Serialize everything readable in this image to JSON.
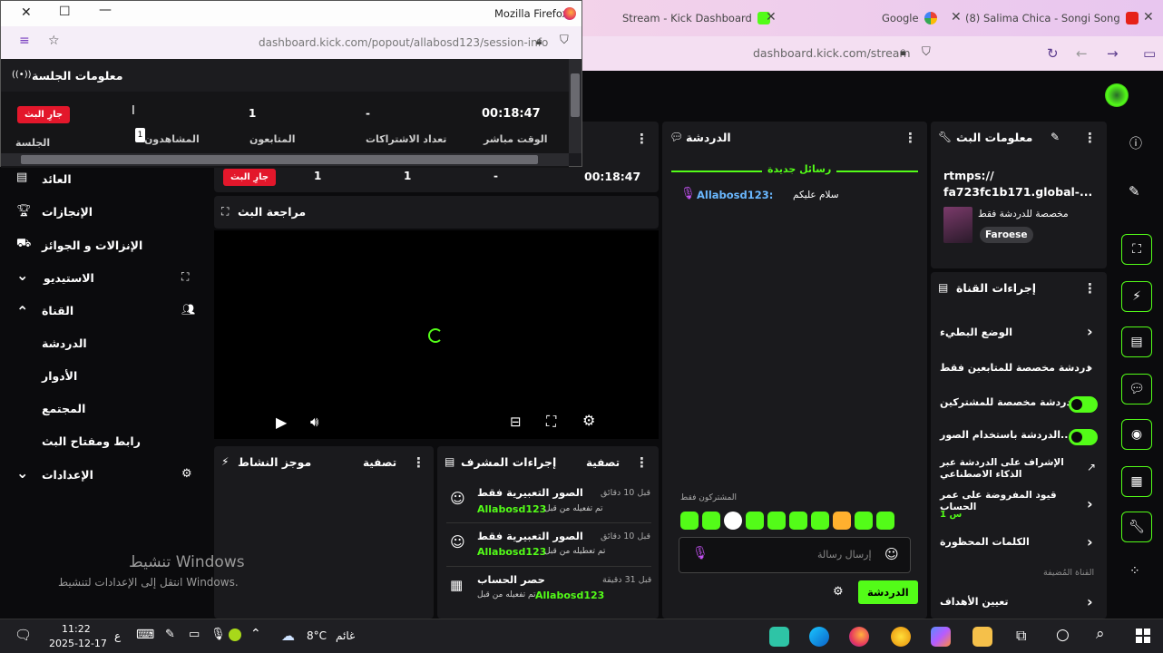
{
  "browser_right": {
    "tabs": [
      {
        "label": "Stream - Kick Dashboard"
      },
      {
        "label": "Google"
      },
      {
        "label": "(8) Salima Chica - Songi Song"
      }
    ],
    "url": "dashboard.kick.com/stream"
  },
  "popout": {
    "app_name": "Mozilla Firefox",
    "url": "dashboard.kick.com/popout/allabosd123/session-info",
    "title": "معلومات الجلسة",
    "live_badge": "جارِ البث",
    "stats": [
      {
        "value": "00:18:47",
        "label": "الوقت مباشر"
      },
      {
        "value": "-",
        "label": "تعداد الاشتراكات"
      },
      {
        "value": "1",
        "label": "المتابعون"
      },
      {
        "value": "1",
        "label": "المشاهدون"
      }
    ],
    "session_label": "الجلسة",
    "cursor_tooltip": "1"
  },
  "sidebar": {
    "items": [
      {
        "label": "العائد"
      },
      {
        "label": "الإنجازات"
      },
      {
        "label": "الإنزالات و الجوائز"
      },
      {
        "label": "الاستيديو"
      },
      {
        "label": "القناة"
      },
      {
        "label": "الدردشة"
      },
      {
        "label": "الأدوار"
      },
      {
        "label": "المجتمع"
      },
      {
        "label": "رابط ومفتاح البث"
      },
      {
        "label": "الإعدادات"
      }
    ]
  },
  "session_row": {
    "live_badge": "جارِ البث",
    "values": [
      "00:18:47",
      "-",
      "1",
      "1"
    ]
  },
  "stream_preview": {
    "title": "مراجعة البث"
  },
  "moderator_actions": {
    "title": "إجراءات المشرف",
    "filter": "تصفية",
    "items": [
      {
        "title": "الصور التعبيرية فقط",
        "user": "Allabosd123",
        "suffix": "تم تفعيله من قبل",
        "time": "قبل 10 دقائق"
      },
      {
        "title": "الصور التعبيرية فقط",
        "user": "Allabosd123",
        "suffix": "تم تعطيله من قبل",
        "time": "قبل 10 دقائق"
      },
      {
        "title": "حصر الحساب",
        "user": "Allabosd123",
        "suffix": "تم تفعيله من قبل",
        "time": "قبل 31 دقيقة"
      }
    ]
  },
  "activity_feed": {
    "title": "موجز النشاط",
    "filter": "تصفية"
  },
  "chat": {
    "title": "الدردشة",
    "new_messages": "رسائل جديدة",
    "message_user": "Allabosd123:",
    "message_text": "سلام عليكم",
    "subscribers_only": "المشتركون فقط",
    "input_placeholder": "إرسال رسالة",
    "send_button": "الدردشة"
  },
  "stream_info": {
    "title": "معلومات البث",
    "rtmps_line1": "rtmps://",
    "rtmps_line2": "fa723fc1b171.global-...",
    "category_label": "مخصصة للدردشة فقط",
    "tag": "Faroese"
  },
  "channel_actions": {
    "title": "إجراءات القناة",
    "items": [
      {
        "label": "الوضع البطيء"
      },
      {
        "label": "دردشة مخصصة للمتابعين فقط"
      },
      {
        "label": "الدردشة مخصصة للمشتركين..."
      },
      {
        "label": "الدردشة باستخدام الصور..."
      },
      {
        "label": "الإشراف على الدردشة عبر الذكاء الاصطناعي"
      },
      {
        "label": "قيود المفروضة على عمر الحساب"
      },
      {
        "label": "الكلمات المحظورة"
      }
    ],
    "account_age_sub": "س 1",
    "section_label": "القناة المُضيفة",
    "goals": "تعيين الأهداف"
  },
  "windows_watermark": {
    "title": "تنشيط Windows",
    "sub": "انتقل إلى الإعدادات لتنشيط Windows."
  },
  "taskbar": {
    "time": "11:22",
    "date": "2025-12-17",
    "weather_temp": "8°C",
    "weather_desc": "غائم",
    "lang": "ع"
  },
  "colors": {
    "accent": "#53fc18",
    "live": "#e3172b",
    "panel": "#1a1a1d",
    "background": "#0b0b0d"
  }
}
